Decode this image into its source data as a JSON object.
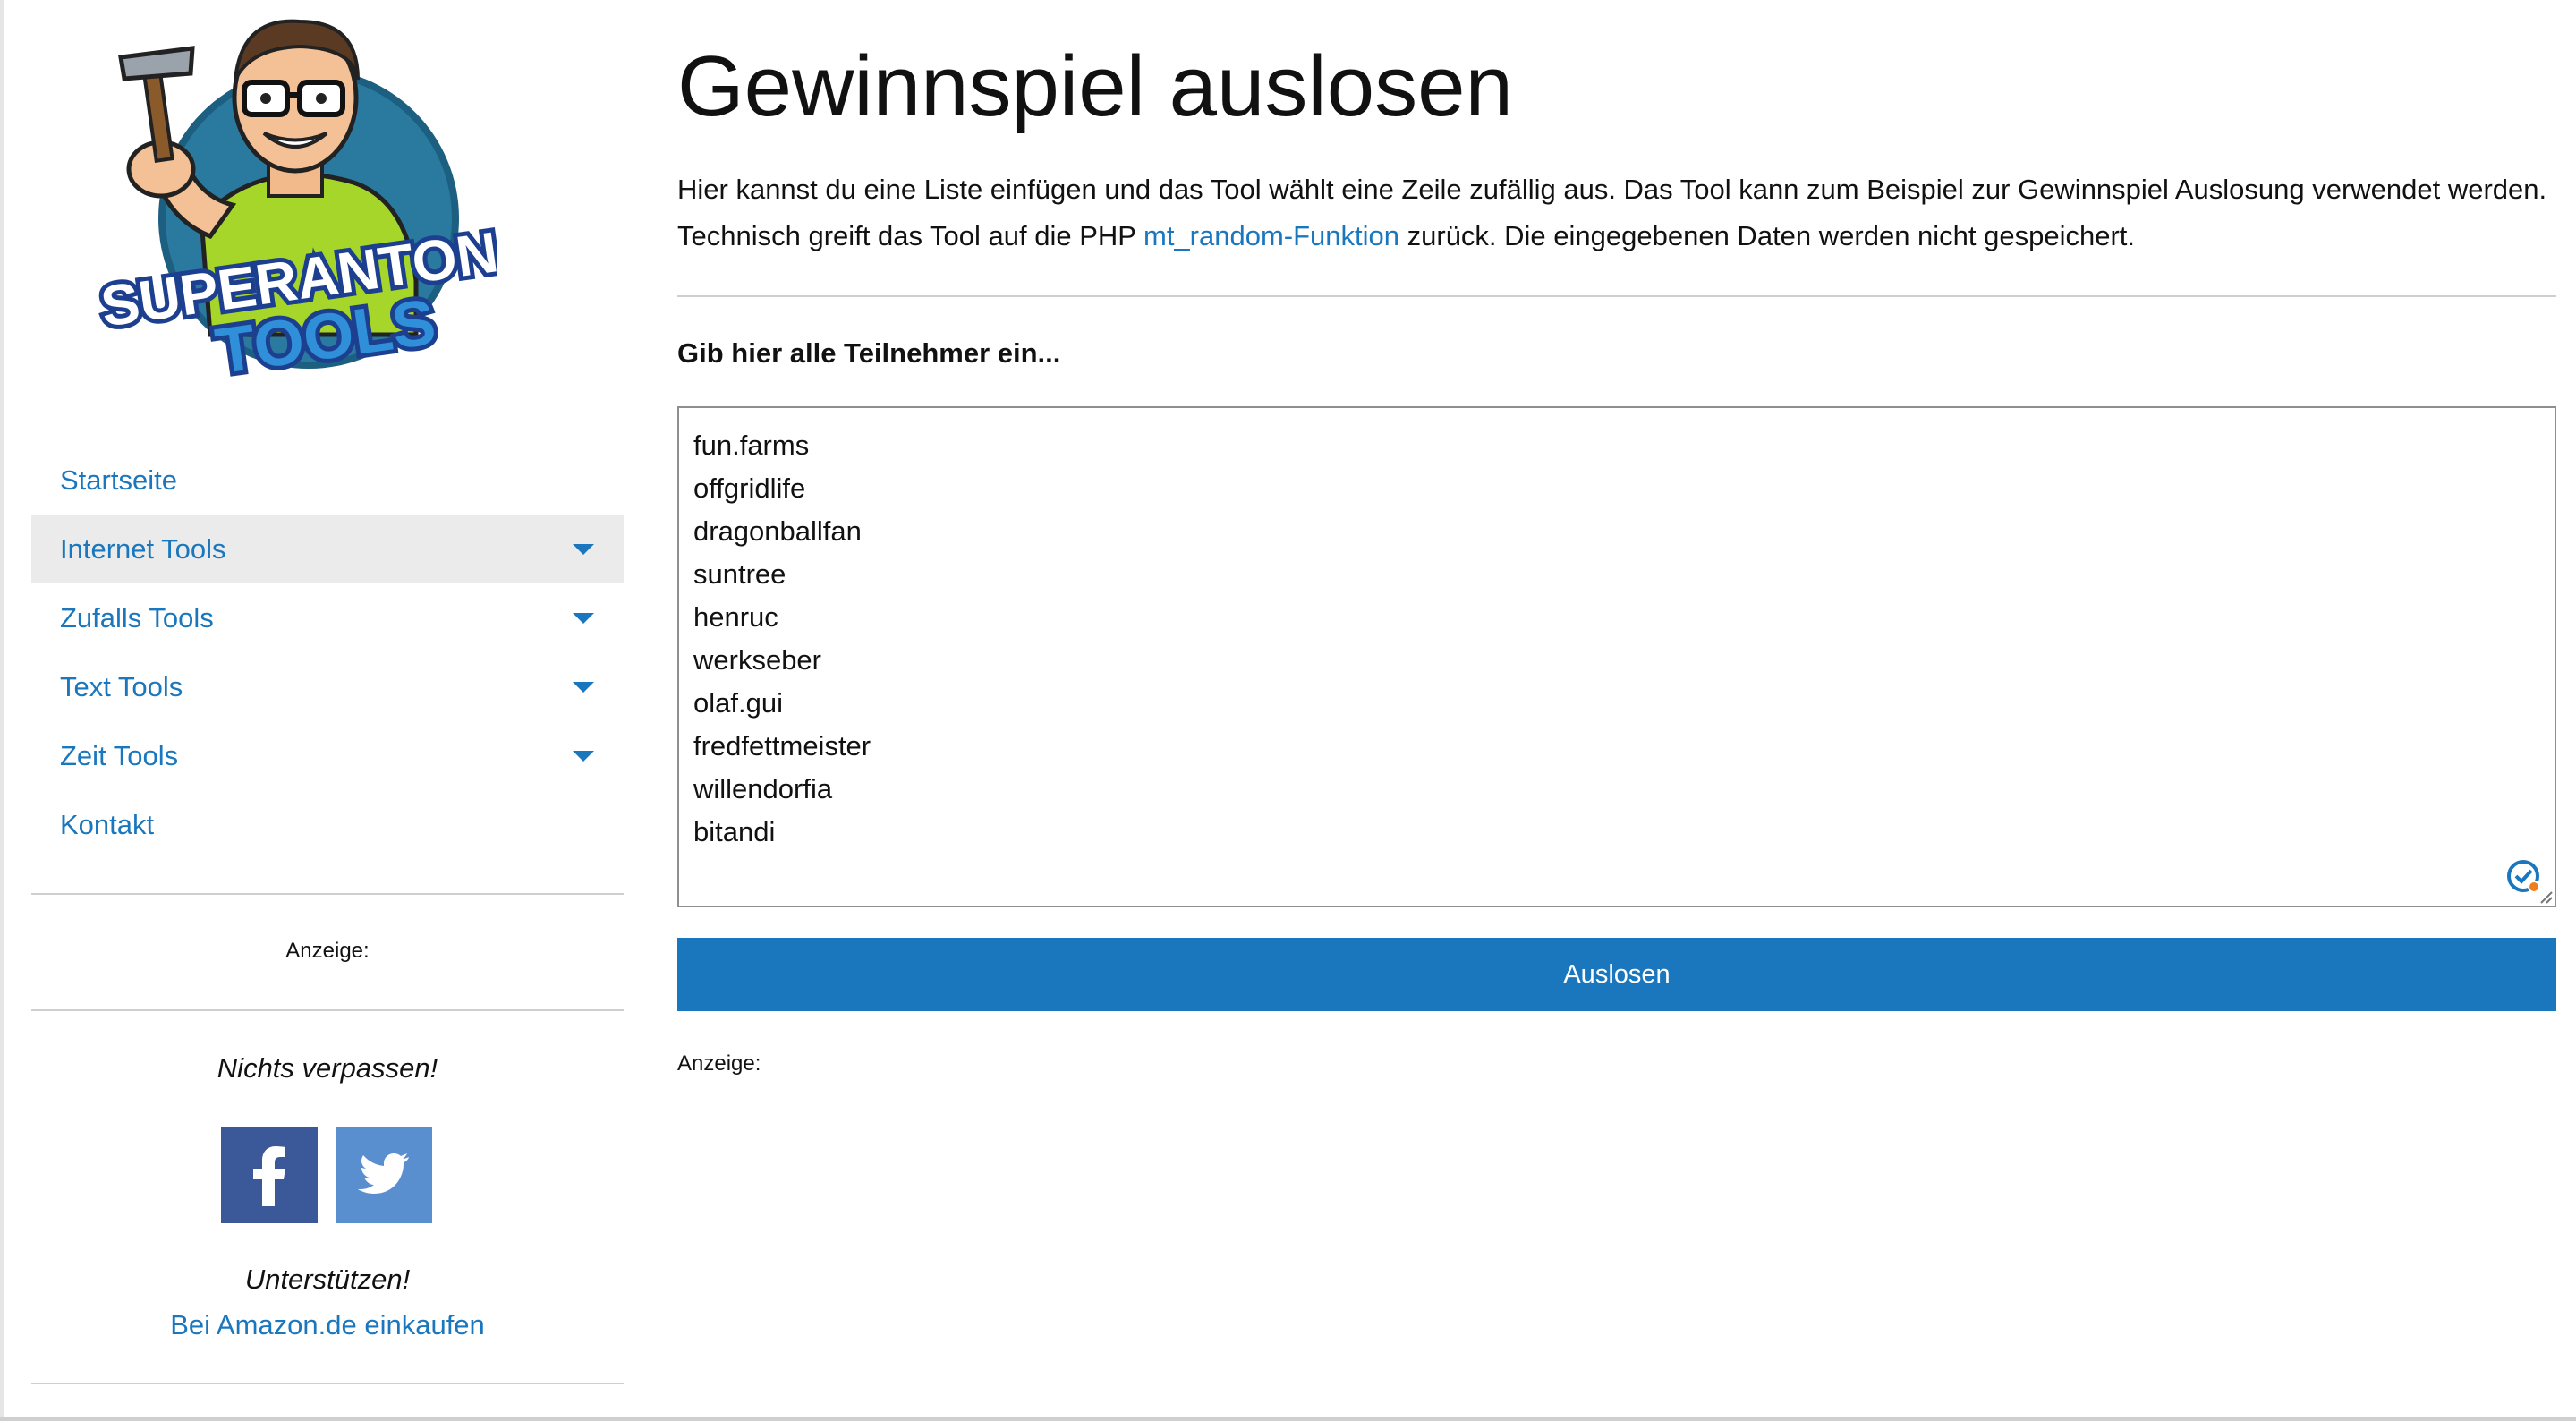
{
  "page": {
    "title": "Gewinnspiel auslosen",
    "intro_part1": "Hier kannst du eine Liste einfügen und das Tool wählt eine Zeile zufällig aus. Das Tool kann zum Beispiel zur Gewinnspiel Auslosung verwendet werden. Technisch greift das Tool auf die PHP ",
    "intro_link": "mt_random-Funktion",
    "intro_part2": " zurück. Die eingegebenen Daten werden nicht gespeichert.",
    "label": "Gib hier alle Teilnehmer ein...",
    "participants": [
      "fun.farms",
      "offgridlife",
      "dragonballfan",
      "suntree",
      "henruc",
      "werkseber",
      "olaf.gui",
      "fredfettmeister",
      "willendorfia",
      "bitandi"
    ],
    "button_label": "Auslosen",
    "ad_label": "Anzeige:"
  },
  "sidebar": {
    "logo_text_1": "SUPERANTON",
    "logo_text_2": "TOOLS",
    "nav": [
      {
        "label": "Startseite",
        "has_dropdown": false,
        "active": false
      },
      {
        "label": "Internet Tools",
        "has_dropdown": true,
        "active": true
      },
      {
        "label": "Zufalls Tools",
        "has_dropdown": true,
        "active": false
      },
      {
        "label": "Text Tools",
        "has_dropdown": true,
        "active": false
      },
      {
        "label": "Zeit Tools",
        "has_dropdown": true,
        "active": false
      },
      {
        "label": "Kontakt",
        "has_dropdown": false,
        "active": false
      }
    ],
    "ad_label": "Anzeige:",
    "follow_title": "Nichts verpassen!",
    "support_title": "Unterstützen!",
    "amazon_link": "Bei Amazon.de einkaufen"
  },
  "icons": {
    "facebook": "facebook-icon",
    "twitter": "twitter-icon",
    "checker": "grammar-check-icon",
    "resize": "resize-handle-icon",
    "dropdown": "caret-down-icon"
  },
  "colors": {
    "accent": "#1a77bd",
    "active_nav_bg": "#ebebeb",
    "facebook": "#3b5998",
    "twitter": "#5a8fcf"
  }
}
